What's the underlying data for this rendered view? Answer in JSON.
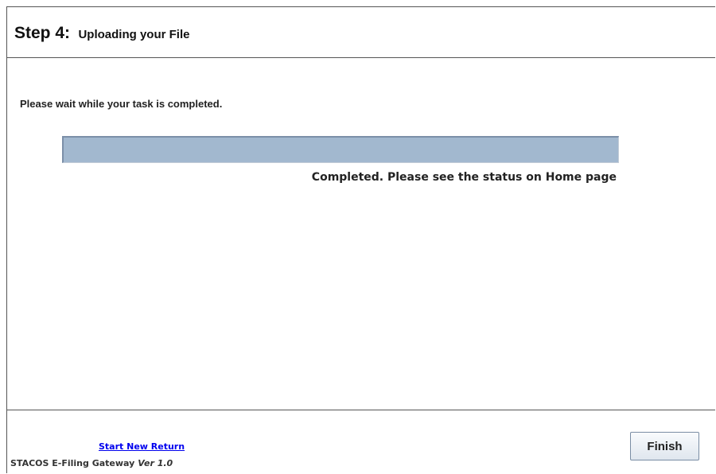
{
  "header": {
    "step_number": "Step 4:",
    "step_name": "Uploading your File"
  },
  "main": {
    "wait_message": "Please wait while your task is completed.",
    "progress_percent": 100,
    "status_message": "Completed. Please see the status on Home page"
  },
  "footer": {
    "start_new_label": "Start New Return",
    "app_name": "STACOS E-Filing Gateway",
    "app_version": "Ver 1.0",
    "finish_label": "Finish"
  },
  "colors": {
    "progress_fill": "#a2b8cf",
    "link": "#0000ee"
  }
}
